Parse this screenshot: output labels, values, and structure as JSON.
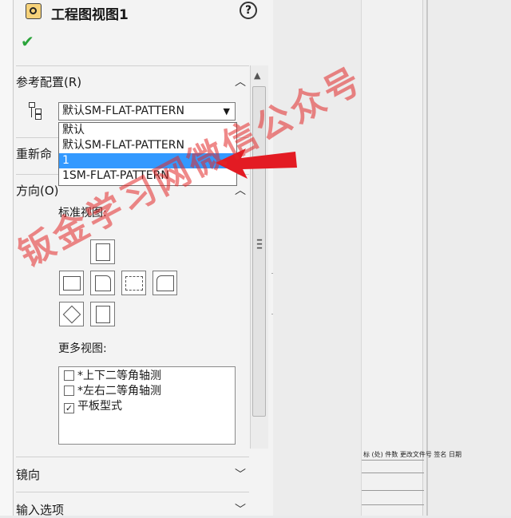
{
  "header": {
    "title": "工程图视图1",
    "help": "?"
  },
  "ok": "✔",
  "sections": {
    "reference_config": {
      "label": "参考配置(R)"
    },
    "regen": {
      "label": "重新命"
    },
    "orientation": {
      "label": "方向(O)"
    },
    "mirror": {
      "label": "镜向"
    },
    "import_options": {
      "label": "输入选项"
    }
  },
  "combo": {
    "value": "默认SM-FLAT-PATTERN",
    "arrow": "▼"
  },
  "dropdown": {
    "options": [
      "默认",
      "默认SM-FLAT-PATTERN",
      "1",
      "1SM-FLAT-PATTERN"
    ],
    "selected_index": 2
  },
  "standard_views": {
    "label": "标准视图:"
  },
  "more_views": {
    "label": "更多视图:",
    "items": [
      {
        "label": "*上下二等角轴测",
        "checked": false
      },
      {
        "label": "*左右二等角轴测",
        "checked": false
      },
      {
        "label": "平板型式",
        "checked": true
      }
    ]
  },
  "chevrons": {
    "up": "︿",
    "down": "﹀"
  },
  "title_block": {
    "text": "标 (处) 件数 更改文件号 签名 日期"
  },
  "watermark": "钣金学习网微信公众号",
  "colors": {
    "selection": "#3399ff",
    "ok": "#2aa43a",
    "watermark": "#e12828",
    "arrow": "#e31b23"
  }
}
